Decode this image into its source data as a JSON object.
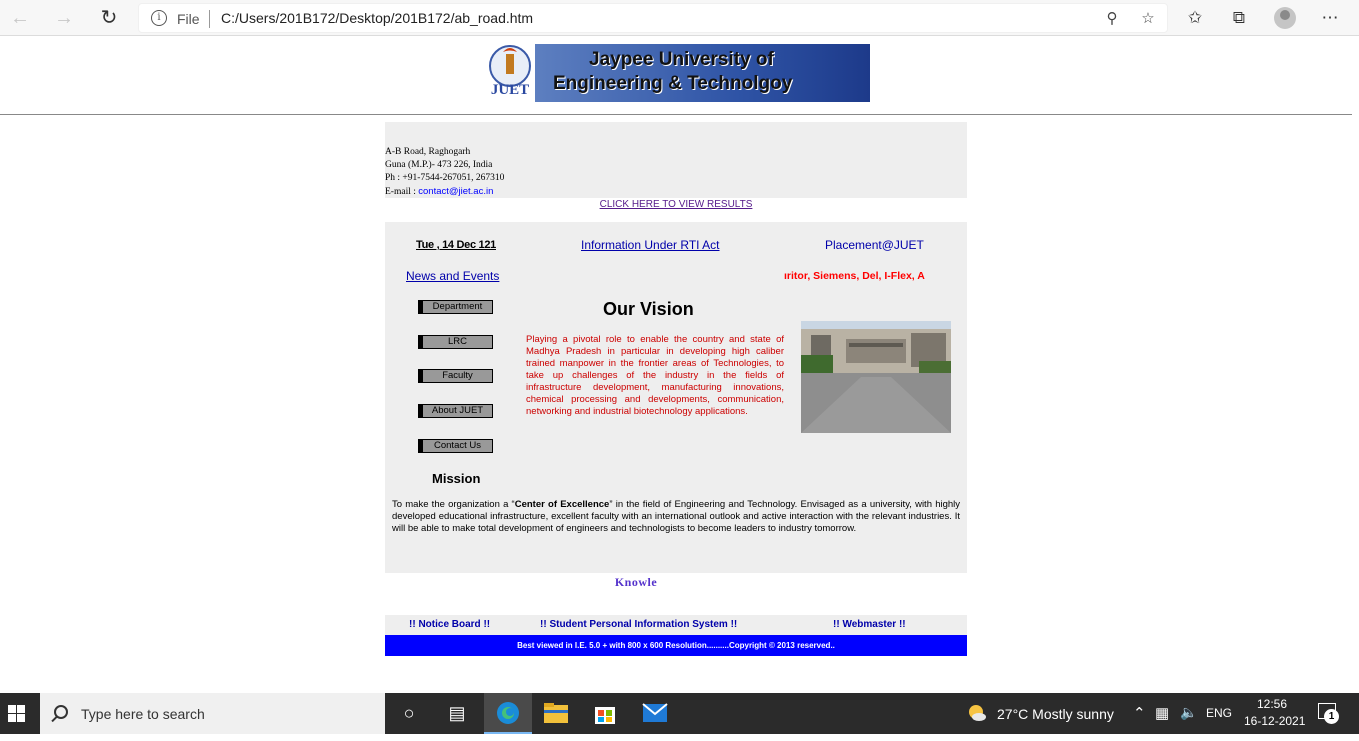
{
  "browser": {
    "file_label": "File",
    "url": "C:/Users/201B172/Desktop/201B172/ab_road.htm"
  },
  "header": {
    "banner_line1": "Jaypee University of",
    "banner_line2": "Engineering & Technolgoy",
    "logo_text": "JUET"
  },
  "address": {
    "line1": "A-B Road, Raghogarh",
    "line2": "Guna (M.P.)- 473 226, India",
    "line3": "Ph : +91-7544-267051, 267310",
    "email_label": "E-mail : ",
    "email": "contact@jiet.ac.in"
  },
  "results_link": "CLICK HERE TO VIEW RESULTS",
  "topbar": {
    "date": "Tue , 14 Dec 121",
    "rti": "Information Under RTI Act",
    "placement": "Placement@JUET",
    "news": "News and Events",
    "marquee": "ıritor, Siemens, Del, I-Flex, A"
  },
  "menu": [
    "Department",
    "LRC",
    "Faculty",
    "About JUET",
    "Contact Us"
  ],
  "vision": {
    "title": "Our Vision",
    "text": "Playing a pivotal role to enable the country and state of Madhya Pradesh in particular in developing high caliber trained manpower in the frontier areas of Technologies, to take up challenges of the industry in the fields of infrastructure development, manufacturing innovations, chemical processing and developments, communication, networking and industrial biotechnology applications."
  },
  "mission": {
    "title": "Mission",
    "text_before": "To make the organization a “",
    "text_bold": "Center of Excellence",
    "text_after": "” in the field of Engineering and Technology. Envisaged as a university, with highly developed educational infrastructure, excellent faculty with an international outlook and active interaction with the relevant industries. It will be able to make total development of engineers and technologists to become leaders to industry tomorrow."
  },
  "knowle": "Knowle",
  "footer": {
    "notice": "!! Notice Board !!",
    "spis": "!! Student Personal Information System !!",
    "webmaster": "!! Webmaster !!",
    "copyright": "Best viewed in I.E. 5.0 + with 800 x 600 Resolution..........Copyright © 2013 reserved.."
  },
  "taskbar": {
    "search_placeholder": "Type here to search",
    "weather": "27°C  Mostly sunny",
    "lang": "ENG",
    "time": "12:56",
    "date": "16-12-2021",
    "notif_count": "1"
  },
  "colors": {
    "page_box": "#eeeeee",
    "link": "#0000aa",
    "vision_text": "#cc0000",
    "footer_bar": "#0000ff"
  }
}
